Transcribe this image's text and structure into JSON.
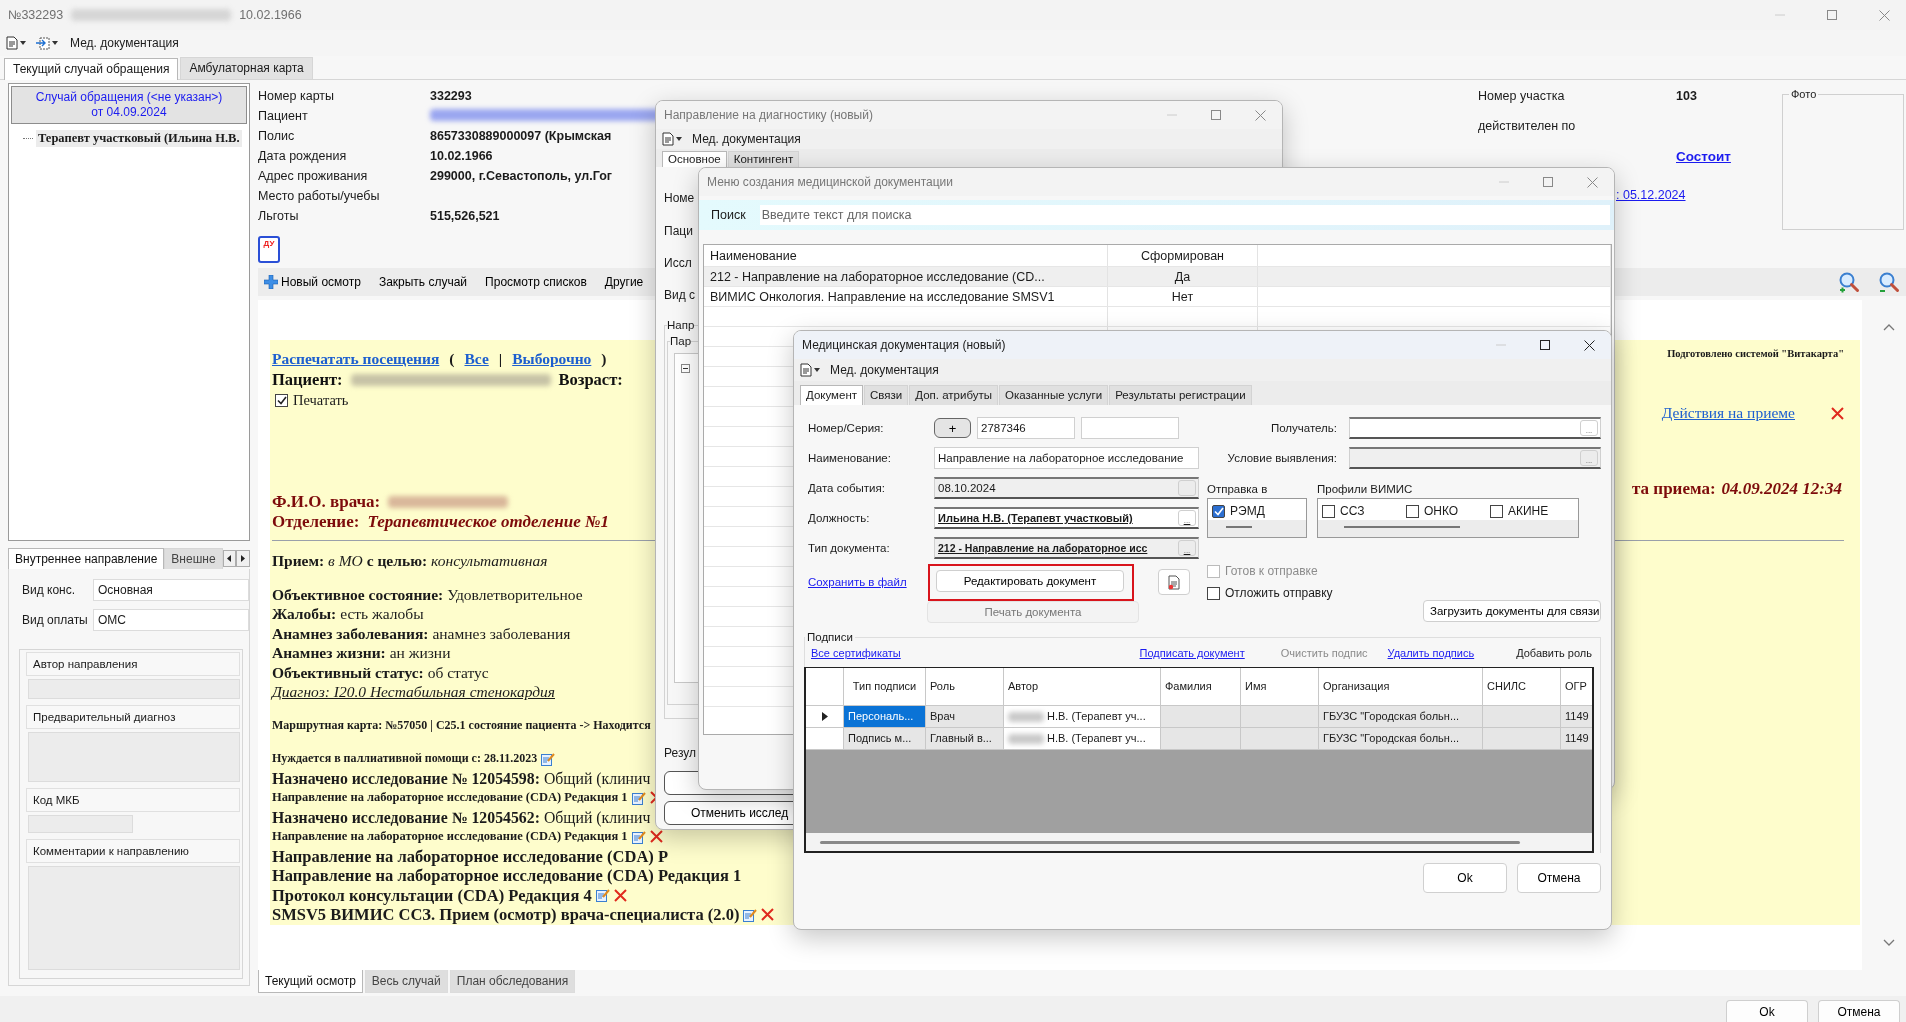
{
  "window": {
    "number": "№332293",
    "date": "10.02.1966"
  },
  "toolbar": {
    "menu": "Мед. документация"
  },
  "main_tabs": [
    {
      "label": "Текущий случай обращения",
      "selected": true
    },
    {
      "label": "Амбулаторная карта",
      "selected": false
    }
  ],
  "case_tree": {
    "header": "Случай обращения (<не указан>)",
    "header_date": "от 04.09.2024",
    "items": [
      {
        "label": "Терапевт участковый (Ильина Н.В.",
        "selected": true
      }
    ]
  },
  "referral": {
    "tabs": [
      {
        "label": "Внутреннее направление",
        "selected": true
      },
      {
        "label": "Внешне",
        "selected": false
      }
    ],
    "fields": [
      {
        "label": "Вид конс.",
        "value": "Основная"
      },
      {
        "label": "Вид оплаты",
        "value": "ОМС"
      }
    ],
    "sections": [
      {
        "label": "Автор направления",
        "kind": "line"
      },
      {
        "label": "Предварительный диагноз",
        "kind": "area"
      },
      {
        "label": "Код МКБ",
        "kind": "short"
      },
      {
        "label": "Комментарии к направлению",
        "kind": "large"
      }
    ]
  },
  "patient": [
    {
      "label": "Номер карты",
      "value": "332293"
    },
    {
      "label": "Пациент",
      "kind": "redacted"
    },
    {
      "label": "Полис",
      "value": "8657330889000097 (Крымская"
    },
    {
      "label": "Дата рождения",
      "value": "10.02.1966"
    },
    {
      "label": "Адрес проживания",
      "value": "299000, г.Севастополь, ул.Гог"
    },
    {
      "label": "Место работы/учебы"
    },
    {
      "label": "Льготы",
      "value": "515,526,521"
    }
  ],
  "du_button": "ДУ",
  "district": {
    "label": "Номер участка",
    "value": "103",
    "valid_label": "действителен по",
    "status_link": "Состоит",
    "date_link": ": 05.12.2024",
    "photo_label": "Фото"
  },
  "actions": [
    {
      "label": "Новый осмотр",
      "kind": "add"
    },
    {
      "label": "Закрыть случай",
      "kind": "plain"
    },
    {
      "label": "Просмотр списков",
      "kind": "plain"
    },
    {
      "label": "Другие",
      "kind": "plain"
    }
  ],
  "visit": {
    "print_row": [
      {
        "kind": "link",
        "text": "Распечатать посещения"
      },
      {
        "kind": "text",
        "text": "("
      },
      {
        "kind": "link",
        "text": "Все"
      },
      {
        "kind": "text",
        "text": "|"
      },
      {
        "kind": "link",
        "text": "Выборочно"
      },
      {
        "kind": "text",
        "text": ")"
      }
    ],
    "patient_label": "Пациент:",
    "age_label": "Возраст:",
    "print_checkbox": {
      "label": "Печатать",
      "checked": true
    },
    "doctor_label": "Ф.И.О. врача:",
    "department_label": "Отделение:",
    "department": "Терапевтическое отделение №1",
    "prepared_by": "Подготовлено системой \"Витакарта\"",
    "actions_link": "Действия на приеме",
    "date_label": "та приема:",
    "date": "04.09.2024 12:34",
    "lines": [
      {
        "kind": "purpose",
        "text": "**Прием:** *в МО* **с целью:** *консультативная*"
      },
      {
        "kind": "field",
        "text": "**Объективное состояние:** Удовлетворительное"
      },
      {
        "kind": "field",
        "text": "**Жалобы:** есть жалобы"
      },
      {
        "kind": "field",
        "text": "**Анамнез заболевания:** анамнез заболевания"
      },
      {
        "kind": "field",
        "text": "**Анамнез жизни:** ан жизни"
      },
      {
        "kind": "field",
        "text": "**Объективный статус:** об статус"
      },
      {
        "kind": "diagnosis",
        "text": "Диагноз: I20.0 Нестабильная стенокардия"
      },
      {
        "kind": "note",
        "text": "Маршрутная карта: №57050 | С25.1 состояние пациента -> Находится"
      },
      {
        "kind": "note",
        "text": "Нуждается в паллиативной помощи с: 28.11.2023",
        "edit_icon": true
      },
      {
        "kind": "entry",
        "text": "**Назначено исследование № 12054598:** Общий (клинич"
      },
      {
        "kind": "doc",
        "text": "Направление на лабораторное исследование (CDA) Редакция 1",
        "edit_icon": true,
        "delete_icon": true
      },
      {
        "kind": "entry",
        "text": "**Назначено исследование № 12054562:** Общий (клинич"
      },
      {
        "kind": "doc",
        "text": "Направление на лабораторное исследование (CDA) Редакция 1",
        "edit_icon": true,
        "delete_icon": true
      },
      {
        "kind": "title",
        "text": "Направление на лабораторное исследование (CDA) Р"
      },
      {
        "kind": "title",
        "text": "Направление на лабораторное исследование (CDA) Редакция 1"
      },
      {
        "kind": "title",
        "text": "Протокол консультации (CDA) Редакция 4",
        "edit_icon": true,
        "delete_icon": true
      },
      {
        "kind": "title",
        "text": "SMSV5 ВИМИС ССЗ. Прием (осмотр) врача-специалиста (2.0)",
        "edit_icon": true,
        "delete_icon": true
      }
    ]
  },
  "bottom_tabs": [
    {
      "label": "Текущий осмотр",
      "selected": true
    },
    {
      "label": "Весь случай",
      "selected": false
    },
    {
      "label": "План обследования",
      "selected": false
    }
  ],
  "footer_buttons": [
    "Ok",
    "Отмена"
  ],
  "diagnostics_dialog": {
    "title": "Направление на диагностику (новый)",
    "toolbar": "Мед. документация",
    "tabs": [
      {
        "label": "Основное",
        "selected": true
      },
      {
        "label": "Контингент",
        "selected": false
      }
    ],
    "labels": [
      "Номе",
      "Паци",
      "Иссл",
      "Вид с"
    ],
    "group_label": "Напр",
    "subgroup_label": "Пар",
    "result_label": "Резул",
    "cancel_button": "Отменить исслед"
  },
  "doc_menu_dialog": {
    "title": "Меню создания медицинской документации",
    "search_label": "Поиск",
    "search_placeholder": "Введите текст для поиска",
    "columns": [
      "Наименование",
      "Сформирован"
    ],
    "rows": [
      {
        "selected": true,
        "cells": [
          "212 - Направление на лабораторное исследование (CD...",
          "Да"
        ]
      },
      {
        "selected": false,
        "cells": [
          "ВИМИС Онкология. Направление на исследование SMSV1",
          "Нет"
        ]
      }
    ]
  },
  "doc_dialog": {
    "title": "Медицинская документация (новый)",
    "toolbar": "Мед. документация",
    "tabs": [
      {
        "label": "Документ",
        "selected": true
      },
      {
        "label": "Связи",
        "selected": false
      },
      {
        "label": "Доп. атрибуты",
        "selected": false
      },
      {
        "label": "Оказанные услуги",
        "selected": false
      },
      {
        "label": "Результаты регистрации",
        "selected": false
      }
    ],
    "number_label": "Номер/Серия:",
    "add_button": "+",
    "number": "2787346",
    "name_label": "Наименование:",
    "name": "Направление на лабораторное исследование",
    "date_label": "Дата события:",
    "date": "08.10.2024",
    "position_label": "Должность:",
    "position": "Ильина Н.В. (Терапевт участковый)",
    "type_label": "Тип документа:",
    "type": "212 - Направление на лабораторное исс",
    "save_link": "Сохранить в файл",
    "edit_button": "Редактировать документ",
    "print_button": "Печать документа",
    "position_browse": "...",
    "type_browse": "...",
    "recipient_browse": "...",
    "condition_browse": "...",
    "recipient_label": "Получатель:",
    "condition_label": "Условие выявления:",
    "send_label": "Отправка в",
    "send_targets": [
      {
        "label": "РЭМД",
        "checked": true
      }
    ],
    "profiles_label": "Профили ВИМИС",
    "profiles": [
      {
        "label": "ССЗ",
        "checked": false
      },
      {
        "label": "ОНКО",
        "checked": false
      },
      {
        "label": "АКИНЕ",
        "checked": false
      }
    ],
    "options": [
      {
        "label": "Готов к отправке",
        "checked": false,
        "disabled": true
      },
      {
        "label": "Отложить отправку",
        "checked": false,
        "disabled": false
      }
    ],
    "load_button": "Загрузить документы для связи",
    "signatures": {
      "title": "Подписи",
      "links": [
        {
          "label": "Все сертификаты",
          "kind": "link"
        },
        {
          "label": "Подписать документ",
          "kind": "link"
        },
        {
          "label": "Очистить подпис",
          "kind": "disabled"
        },
        {
          "label": "Удалить подпись",
          "kind": "link"
        },
        {
          "label": "Добавить роль",
          "kind": "button"
        }
      ],
      "columns": [
        {
          "label": "Тип подписи",
          "kind": "text"
        },
        {
          "label": "Роль",
          "kind": "text"
        },
        {
          "label": "Автор",
          "kind": "person"
        },
        {
          "label": "Фамилия",
          "kind": "text"
        },
        {
          "label": "Имя",
          "kind": "text"
        },
        {
          "label": "Организация",
          "kind": "text"
        },
        {
          "label": "СНИЛС",
          "kind": "text"
        },
        {
          "label": "ОГР",
          "kind": "text"
        }
      ],
      "rows": [
        {
          "selected": true,
          "cells": [
            "Персональ...",
            "Врач",
            "Н.В. (Терапевт уч...",
            null,
            null,
            "ГБУЗС \"Городская больн...",
            null,
            "1149"
          ]
        },
        {
          "selected": false,
          "cells": [
            "Подпись м...",
            "Главный в...",
            "Н.В. (Терапевт уч...",
            null,
            null,
            "ГБУЗС \"Городская больн...",
            null,
            "1149"
          ]
        }
      ]
    },
    "buttons": [
      "Ok",
      "Отмена"
    ]
  }
}
